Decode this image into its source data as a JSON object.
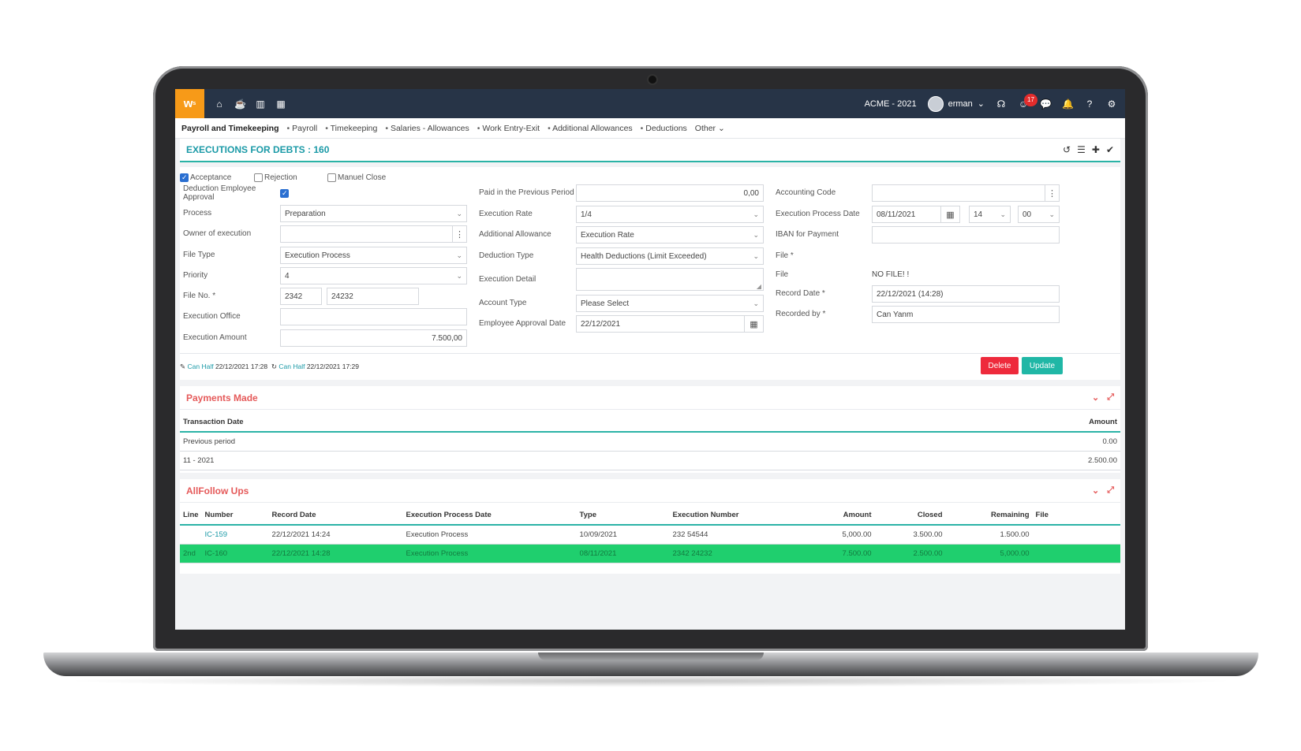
{
  "topbar": {
    "logo": "w",
    "company": "ACME - 2021",
    "user": "erman",
    "notif_count": "17"
  },
  "nav": {
    "first": "Payroll and Timekeeping",
    "items": [
      "Payroll",
      "Timekeeping",
      "Salaries - Allowances",
      "Work Entry-Exit",
      "Additional Allowances",
      "Deductions"
    ],
    "other": "Other"
  },
  "title": "EXECUTIONS FOR DEBTS : 160",
  "form": {
    "acceptance": "Acceptance",
    "rejection": "Rejection",
    "manuel_close": "Manuel Close",
    "ded_emp_approval": "Deduction Employee Approval",
    "process_l": "Process",
    "process_v": "Preparation",
    "owner_l": "Owner of execution",
    "filetype_l": "File Type",
    "filetype_v": "Execution Process",
    "priority_l": "Priority",
    "priority_v": "4",
    "fileno_l": "File No. *",
    "fileno_v1": "2342",
    "fileno_v2": "24232",
    "office_l": "Execution Office",
    "amount_l": "Execution Amount",
    "amount_v": "7.500,00",
    "paid_prev_l": "Paid in the Previous Period",
    "paid_prev_v": "0,00",
    "rate_l": "Execution Rate",
    "rate_v": "1/4",
    "add_allow_l": "Additional Allowance",
    "add_allow_v": "Execution Rate",
    "ded_type_l": "Deduction Type",
    "ded_type_v": "Health Deductions (Limit Exceeded)",
    "detail_l": "Execution Detail",
    "acc_type_l": "Account Type",
    "acc_type_v": "Please Select",
    "emp_appr_date_l": "Employee Approval Date",
    "emp_appr_date_v": "22/12/2021",
    "acc_code_l": "Accounting Code",
    "exec_proc_date_l": "Execution Process Date",
    "exec_proc_date_v": "08/11/2021",
    "hour_v": "14",
    "min_v": "00",
    "iban_l": "IBAN for Payment",
    "file_req_l": "File *",
    "file_l": "File",
    "file_v": "NO FILE! !",
    "record_date_l": "Record Date *",
    "record_date_v": "22/12/2021 (14:28)",
    "recorded_by_l": "Recorded by *",
    "recorded_by_v": "Can Yanm",
    "edit_user": "Can Half",
    "edit_time": "22/12/2021 17:28",
    "upd_user": "Can Half",
    "upd_time": "22/12/2021 17:29",
    "delete": "Delete",
    "update": "Update"
  },
  "payments": {
    "title": "Payments Made",
    "headers": [
      "Transaction Date",
      "Amount"
    ],
    "rows": [
      [
        "Previous period",
        "0.00"
      ],
      [
        "11 - 2021",
        "2.500.00"
      ]
    ]
  },
  "followups": {
    "title": "AllFollow Ups",
    "headers": [
      "Line",
      "Number",
      "Record Date",
      "Execution Process Date",
      "Type",
      "Execution Number",
      "Amount",
      "Closed",
      "Remaining",
      "File"
    ],
    "rows": [
      [
        "",
        "IC-159",
        "22/12/2021 14:24",
        "Execution Process",
        "10/09/2021",
        "232 54544",
        "5,000.00",
        "3.500.00",
        "1.500.00",
        ""
      ],
      [
        "2nd",
        "IC-160",
        "22/12/2021 14:28",
        "Execution Process",
        "08/11/2021",
        "2342 24232",
        "7.500.00",
        "2.500.00",
        "5,000.00",
        ""
      ]
    ]
  }
}
